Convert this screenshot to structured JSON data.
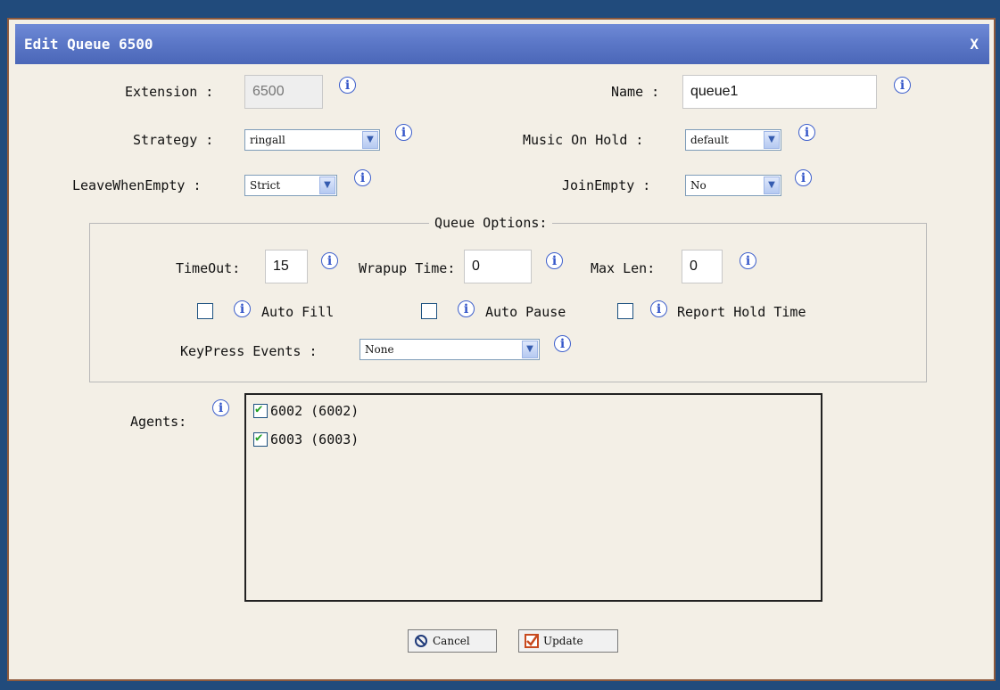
{
  "dialog": {
    "title": "Edit Queue 6500",
    "close_label": "X"
  },
  "fields": {
    "extension": {
      "label": "Extension :",
      "value": "6500"
    },
    "name": {
      "label": "Name :",
      "value": "queue1"
    },
    "strategy": {
      "label": "Strategy :",
      "value": "ringall"
    },
    "music_on_hold": {
      "label": "Music On Hold :",
      "value": "default"
    },
    "leave_when_empty": {
      "label": "LeaveWhenEmpty :",
      "value": "Strict"
    },
    "join_empty": {
      "label": "JoinEmpty :",
      "value": "No"
    }
  },
  "queue_options": {
    "legend": "Queue Options:",
    "timeout": {
      "label": "TimeOut:",
      "value": "15"
    },
    "wrapup_time": {
      "label": "Wrapup Time:",
      "value": "0"
    },
    "max_len": {
      "label": "Max Len:",
      "value": "0"
    },
    "auto_fill": {
      "label": "Auto Fill",
      "checked": false
    },
    "auto_pause": {
      "label": "Auto Pause",
      "checked": false
    },
    "report_hold_time": {
      "label": "Report Hold Time",
      "checked": false
    },
    "keypress_events": {
      "label": "KeyPress Events :",
      "value": "None"
    }
  },
  "agents": {
    "label": "Agents:",
    "items": [
      {
        "label": "6002 (6002)",
        "checked": true
      },
      {
        "label": "6003 (6003)",
        "checked": true
      }
    ]
  },
  "buttons": {
    "cancel": "Cancel",
    "update": "Update"
  },
  "icons": {
    "info": "i",
    "select_arrow": "▼"
  },
  "colors": {
    "titlebar": "#5c78c8",
    "accent_check": "#21a121",
    "info": "#3557c9"
  }
}
